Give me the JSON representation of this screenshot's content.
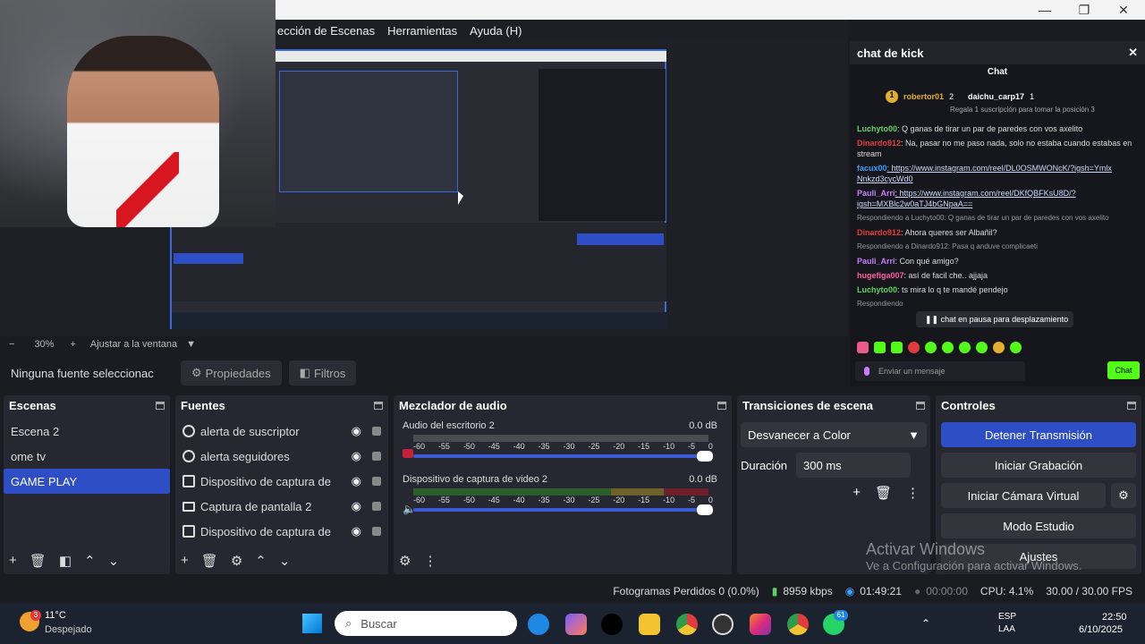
{
  "menu": [
    "ección de Escenas",
    "Herramientas",
    "Ayuda (H)"
  ],
  "window_buttons": {
    "minimize": "—",
    "restore": "❐",
    "close": "✕"
  },
  "preview": {
    "zoom_minus": "−",
    "zoom_value": "30%",
    "zoom_plus": "+",
    "fit_label": "Ajustar a la ventana"
  },
  "props_bar": {
    "no_source": "Ninguna fuente seleccionac",
    "properties": "Propiedades",
    "filters": "Filtros"
  },
  "scenes": {
    "title": "Escenas",
    "items": [
      {
        "label": "Escena 2",
        "selected": false
      },
      {
        "label": "ome tv",
        "selected": false
      },
      {
        "label": "GAME PLAY",
        "selected": true
      }
    ]
  },
  "sources": {
    "title": "Fuentes",
    "items": [
      {
        "label": "alerta de suscriptor",
        "icon": "browser-icon"
      },
      {
        "label": "alerta seguidores",
        "icon": "browser-icon"
      },
      {
        "label": "Dispositivo de captura de",
        "icon": "camera-icon"
      },
      {
        "label": "Captura de pantalla 2",
        "icon": "monitor-icon"
      },
      {
        "label": "Dispositivo de captura de",
        "icon": "camera-icon"
      }
    ]
  },
  "mixer": {
    "title": "Mezclador de audio",
    "channels": [
      {
        "name": "Audio del escritorio 2",
        "db": "0.0 dB",
        "muted": true
      },
      {
        "name": "Dispositivo de captura de video 2",
        "db": "0.0 dB",
        "muted": false
      }
    ],
    "scale": [
      "-60",
      "-55",
      "-50",
      "-45",
      "-40",
      "-35",
      "-30",
      "-25",
      "-20",
      "-15",
      "-10",
      "-5",
      "0"
    ]
  },
  "transitions": {
    "title": "Transiciones de escena",
    "selected": "Desvanecer a Color",
    "duration_label": "Duración",
    "duration_value": "300 ms"
  },
  "controls": {
    "title": "Controles",
    "stop_stream": "Detener Transmisión",
    "start_recording": "Iniciar Grabación",
    "virtual_cam": "Iniciar Cámara Virtual",
    "studio_mode": "Modo Estudio",
    "settings": "Ajustes"
  },
  "watermark": {
    "line1": "Activar Windows",
    "line2": "Ve a Configuración para activar Windows."
  },
  "chat": {
    "title": "chat de kick",
    "tab": "Chat",
    "top_user1": "robertor01",
    "top_user1_count": "2",
    "top_user2": "daichu_carp17",
    "top_user2_count": "1",
    "gift_note": "Regala 1 suscripción para tomar la posición 3",
    "messages": [
      {
        "user": "Luchyto00",
        "text": ": Q ganas de tirar un par de paredes con vos axelito",
        "color": "#5fd35f"
      },
      {
        "user": "Dinardo912",
        "text": ": Na, pasar no me paso nada, solo no estaba cuando estabas en stream",
        "color": "#e23b3b"
      },
      {
        "user": "facux00",
        "text": ": https://www.instagram.com/reel/DL0OSMWONcK/?igsh=Ymlx Nnkzd3cycWd0",
        "color": "#3aa0ff"
      },
      {
        "user": "Pauli_Arri",
        "text": ": https://www.instagram.com/reel/DKfQBFKsU8D/?igsh=MXBlc2w0aTJ4bGNpaA==",
        "color": "#c77dff"
      },
      {
        "user": "Dinardo912",
        "text": ": Ahora queres ser Albañil?",
        "color": "#e23b3b"
      },
      {
        "user": "Pauli_Arri",
        "text": ": Con qué amigo?",
        "color": "#c77dff"
      },
      {
        "user": "hugefiga007",
        "text": ": así de facil che.. ajjaja",
        "color": "#ff5fa2"
      },
      {
        "user": "Luchyto00",
        "text": ": ts mira lo q te mandé pendejo",
        "color": "#5fd35f"
      }
    ],
    "reply1": "Respondiendo a Luchyto00: Q ganas de tirar un par de paredes con vos axelito",
    "reply2": "Respondiendo a Dinardo912: Pasa q anduve complicaeti",
    "reply3": "Respondiendo",
    "paused": "chat en pausa para desplazamiento",
    "input_placeholder": "Enviar un mensaje",
    "send": "Chat"
  },
  "status": {
    "dropped_frames": "Fotogramas Perdidos 0 (0.0%)",
    "bitrate": "8959 kbps",
    "stream_time": "01:49:21",
    "record_time": "00:00:00",
    "cpu": "CPU: 4.1%",
    "fps": "30.00 / 30.00 FPS"
  },
  "taskbar": {
    "weather_temp": "11°C",
    "weather_desc": "Despejado",
    "weather_badge": "3",
    "search_placeholder": "Buscar",
    "lang1": "ESP",
    "lang2": "LAA",
    "time": "22:50",
    "date": "6/10/2025",
    "whatsapp_badge": "61"
  },
  "colors": {
    "accent": "#2d4ec4",
    "panel": "#262730",
    "background": "#1b1c22",
    "kick_green": "#53fc18"
  }
}
